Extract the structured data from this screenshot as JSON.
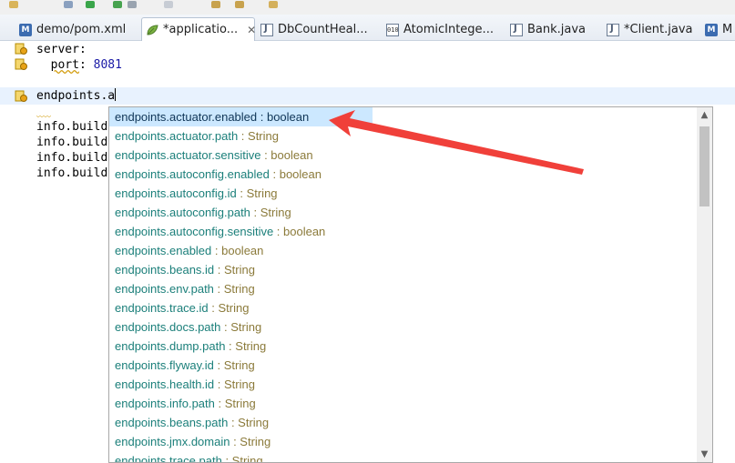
{
  "tabs": [
    {
      "label": "demo/pom.xml",
      "icon": "maven-icon",
      "active": false
    },
    {
      "label": "*applicatio...",
      "icon": "yaml-leaf-icon",
      "active": true,
      "close": "✕"
    },
    {
      "label": "DbCountHeal...",
      "icon": "java-file-icon",
      "active": false
    },
    {
      "label": "AtomicIntege...",
      "icon": "class-file-icon",
      "active": false
    },
    {
      "label": "Bank.java",
      "icon": "java-file-icon",
      "active": false
    },
    {
      "label": "*Client.java",
      "icon": "java-file-icon",
      "active": false
    },
    {
      "label": "M",
      "icon": "maven-icon",
      "active": false
    }
  ],
  "editor": {
    "lines": [
      {
        "text": "server:"
      },
      {
        "prefix": "  ",
        "key": "port",
        "sep": ": ",
        "value": "8081"
      },
      {
        "text": "endpoints.a"
      },
      {
        "text": "info.build"
      },
      {
        "text": "info.build"
      },
      {
        "text": "info.build"
      },
      {
        "text": "info.build"
      }
    ]
  },
  "assist": {
    "typed": "endpoints.a",
    "proposals": [
      {
        "match": "endpoints.a",
        "rest": "ctuator.enabled",
        "type": " : boolean"
      },
      {
        "match": "endpoints.a",
        "rest": "ctuator.path",
        "type": " : String"
      },
      {
        "match": "endpoints.a",
        "rest": "ctuator.sensitive",
        "type": " : boolean"
      },
      {
        "match": "endpoints.a",
        "rest": "utoconfig.enabled",
        "type": " : boolean"
      },
      {
        "match": "endpoints.a",
        "rest": "utoconfig.id",
        "type": " : String"
      },
      {
        "match": "endpoints.a",
        "rest": "utoconfig.path",
        "type": " : String"
      },
      {
        "match": "endpoints.a",
        "rest": "utoconfig.sensitive",
        "type": " : boolean"
      },
      {
        "match": "endpoints.",
        "rest": "enabled",
        "type": " : boolean"
      },
      {
        "match": "endpoints.",
        "rest": "beans.id",
        "type": " : String"
      },
      {
        "match": "endpoints.",
        "rest": "env.path",
        "type": " : String"
      },
      {
        "match": "endpoints.",
        "rest": "trace.id",
        "type": " : String"
      },
      {
        "match": "endpoints.",
        "rest": "docs.path",
        "type": " : String"
      },
      {
        "match": "endpoints.",
        "rest": "dump.path",
        "type": " : String"
      },
      {
        "match": "endpoints.",
        "rest": "flyway.id",
        "type": " : String"
      },
      {
        "match": "endpoints.",
        "rest": "health.id",
        "type": " : String"
      },
      {
        "match": "endpoints.",
        "rest": "info.path",
        "type": " : String"
      },
      {
        "match": "endpoints.",
        "rest": "beans.path",
        "type": " : String"
      },
      {
        "match": "endpoints.",
        "rest": "jmx.domain",
        "type": " : String"
      },
      {
        "match": "endpoints.",
        "rest": "trace.path",
        "type": " : String"
      }
    ],
    "scroll_up": "▲",
    "scroll_down": "▼"
  },
  "colors": {
    "selection": "#cce8ff",
    "annotation_arrow": "#f0403a",
    "property_name": "#1b7f7a",
    "property_type": "#8b7a3a"
  }
}
